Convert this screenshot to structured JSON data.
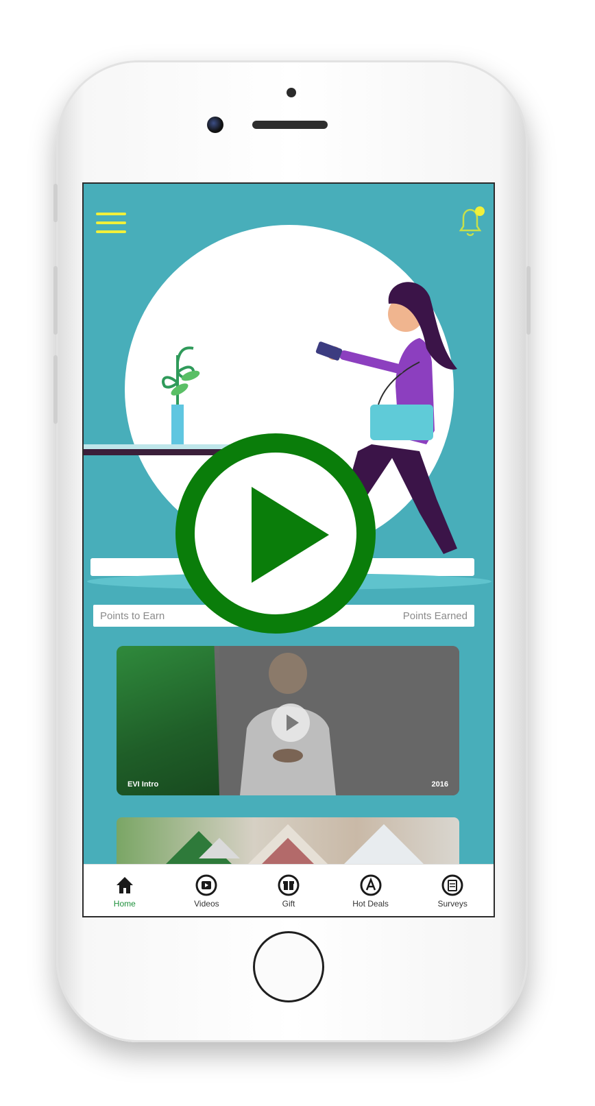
{
  "app": {
    "accent_color": "#48aeba",
    "highlight_color": "#f1f03a",
    "play_overlay_color": "#0a7d0a"
  },
  "header": {
    "menu_icon": "hamburger-menu-icon",
    "notification_icon": "bell-icon"
  },
  "points": {
    "to_earn_label": "Points to Earn",
    "earned_label": "Points Earned"
  },
  "video_card": {
    "left_label": "EVI Intro",
    "right_label": "2016"
  },
  "nav": {
    "items": [
      {
        "label": "Home",
        "icon": "home-icon",
        "active": true
      },
      {
        "label": "Videos",
        "icon": "video-icon",
        "active": false
      },
      {
        "label": "Gift",
        "icon": "gift-icon",
        "active": false
      },
      {
        "label": "Hot Deals",
        "icon": "hot-deals-icon",
        "active": false
      },
      {
        "label": "Surveys",
        "icon": "survey-icon",
        "active": false
      }
    ]
  }
}
